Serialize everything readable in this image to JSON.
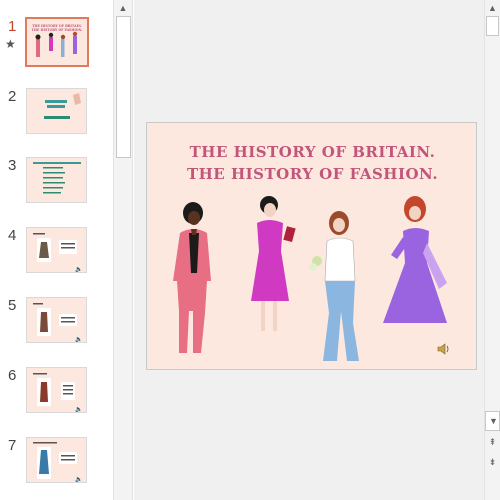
{
  "thumbnails": [
    {
      "number": "1",
      "active": true,
      "has_animation_star": true,
      "star_glyph": "★",
      "title_lines": [
        "THE HISTORY OF BRITAIN.",
        "THE HISTORY OF FASHION."
      ]
    },
    {
      "number": "2",
      "active": false
    },
    {
      "number": "3",
      "active": false
    },
    {
      "number": "4",
      "active": false
    },
    {
      "number": "5",
      "active": false
    },
    {
      "number": "6",
      "active": false
    },
    {
      "number": "7",
      "active": false
    }
  ],
  "slide": {
    "title_line1": "THE HISTORY OF BRITAIN.",
    "title_line2": "THE HISTORY OF FASHION.",
    "background": "#fce8de",
    "title_color": "#c2557a",
    "speaker_icon": "speaker-icon"
  },
  "scroll_arrows": {
    "up": "▲",
    "down": "▼",
    "prev_slide": "⇞",
    "next_slide": "⇟"
  },
  "colors": {
    "active_thumb_border": "#e07a5a",
    "active_number": "#c4462b",
    "editor_bg": "#f0f0f0"
  }
}
